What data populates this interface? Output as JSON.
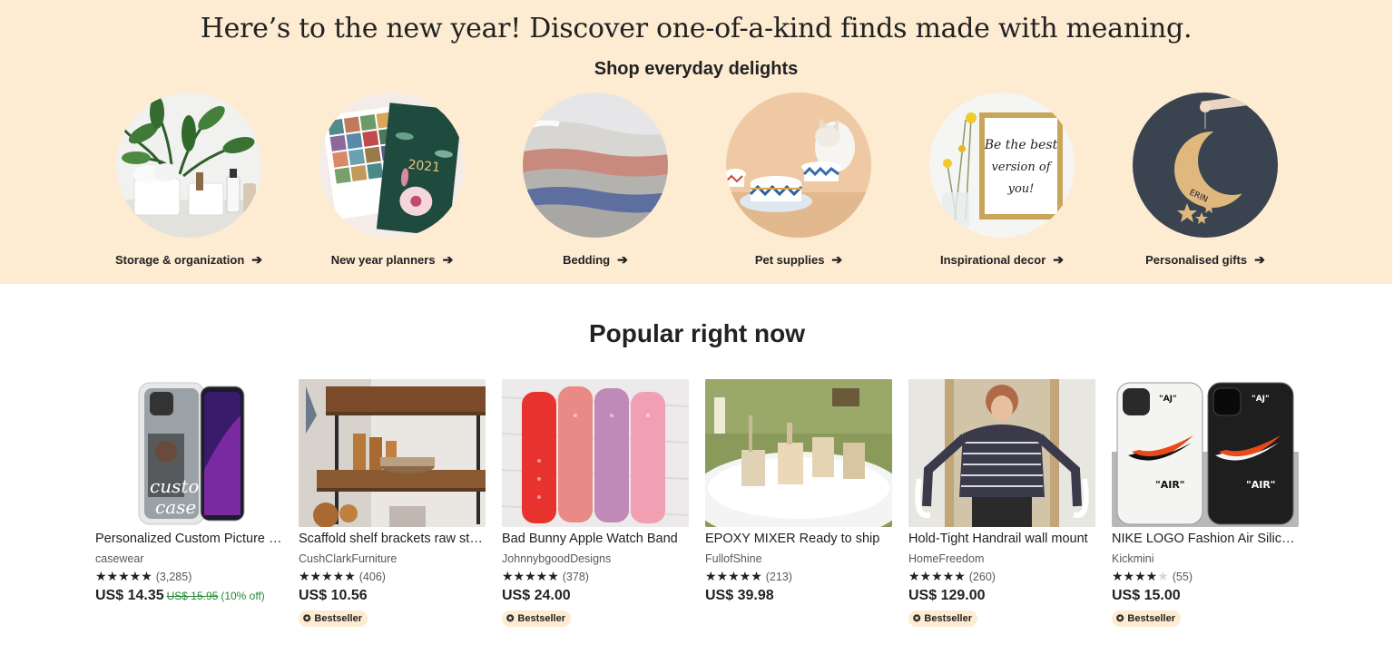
{
  "hero": {
    "headline": "Here’s to the new year! Discover one-of-a-kind finds made with meaning.",
    "subheading": "Shop everyday delights",
    "background_color": "#fdebd2",
    "categories": [
      {
        "label": "Storage & organization",
        "icon": "arrow-right-icon"
      },
      {
        "label": "New year planners",
        "icon": "arrow-right-icon"
      },
      {
        "label": "Bedding",
        "icon": "arrow-right-icon"
      },
      {
        "label": "Pet supplies",
        "icon": "arrow-right-icon"
      },
      {
        "label": "Inspirational decor",
        "icon": "arrow-right-icon"
      },
      {
        "label": "Personalised gifts",
        "icon": "arrow-right-icon"
      }
    ],
    "image_text": {
      "planner_year": "2021",
      "decor_quote": [
        "Be the best",
        "version of",
        "you!"
      ],
      "gift_name": "ERIN"
    }
  },
  "popular": {
    "title": "Popular right now",
    "items": [
      {
        "title": "Personalized Custom Picture Phone Case",
        "shop": "casewear",
        "stars": "★★★★★",
        "stars_off": "",
        "rating_count": "(3,285)",
        "price": "US$ 14.35",
        "original_price": "US$ 15.95",
        "discount": "(10% off)",
        "badge": "",
        "image_text": [
          "custom",
          "case"
        ]
      },
      {
        "title": "Scaffold shelf brackets raw steel",
        "shop": "CushClarkFurniture",
        "stars": "★★★★★",
        "stars_off": "",
        "rating_count": "(406)",
        "price": "US$ 10.56",
        "original_price": "",
        "discount": "",
        "badge": "Bestseller"
      },
      {
        "title": "Bad Bunny Apple Watch Band",
        "shop": "JohnnybgoodDesigns",
        "stars": "★★★★★",
        "stars_off": "",
        "rating_count": "(378)",
        "price": "US$ 24.00",
        "original_price": "",
        "discount": "",
        "badge": "Bestseller"
      },
      {
        "title": "EPOXY MIXER Ready to ship",
        "shop": "FullofShine",
        "stars": "★★★★★",
        "stars_off": "",
        "rating_count": "(213)",
        "price": "US$ 39.98",
        "original_price": "",
        "discount": "",
        "badge": ""
      },
      {
        "title": "Hold-Tight Handrail wall mount",
        "shop": "HomeFreedom",
        "stars": "★★★★★",
        "stars_off": "",
        "rating_count": "(260)",
        "price": "US$ 129.00",
        "original_price": "",
        "discount": "",
        "badge": "Bestseller"
      },
      {
        "title": "NIKE LOGO Fashion Air Silicone Case",
        "shop": "Kickmini",
        "stars": "★★★★",
        "stars_off": "★",
        "rating_count": "(55)",
        "price": "US$ 15.00",
        "original_price": "",
        "discount": "",
        "badge": "Bestseller",
        "image_text": [
          "\"AJ\"",
          "\"AIR\""
        ]
      }
    ],
    "badge_icon": "medal-icon",
    "sale_color": "#258635"
  }
}
